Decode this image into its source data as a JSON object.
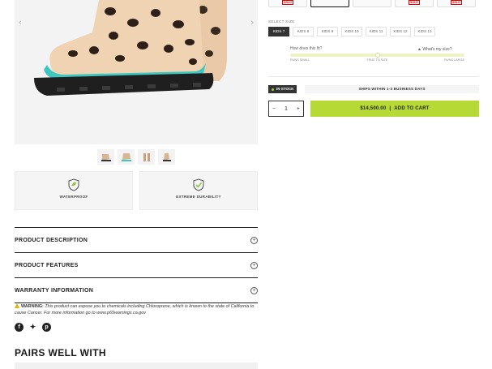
{
  "gallery": {
    "prev": "‹",
    "next": "›"
  },
  "features": [
    {
      "label": "Waterproof",
      "icon": "leaf-shield-icon"
    },
    {
      "label": "Extreme Durability",
      "icon": "check-shield-icon"
    }
  ],
  "accordion": [
    {
      "label": "PRODUCT DESCRIPTION"
    },
    {
      "label": "PRODUCT FEATURES"
    },
    {
      "label": "WARRANTY INFORMATION"
    }
  ],
  "warning": {
    "lead": "WARNING:",
    "text": "This product can expose you to chemicals including Chloroprene, which is known to the state of California to cause Cancer. For more information go to www.p65warnings.ca.gov"
  },
  "social": [
    "facebook-icon",
    "twitter-icon",
    "pinterest-icon"
  ],
  "pairs_title": "PAIRS WELL WITH",
  "sizes": {
    "label": "SELECT SIZE",
    "options": [
      "KIDS 7",
      "KIDS 8",
      "KIDS 9",
      "KIDS 10",
      "KIDS 11",
      "KIDS 12",
      "KIDS 13"
    ],
    "selected": "KIDS 7"
  },
  "fit": {
    "question": "How does this fit?",
    "link": "What's my size?",
    "scale": [
      "RUNS SMALL",
      "TRUE TO SIZE",
      "RUNS LARGE"
    ],
    "value": 0.5
  },
  "stock": {
    "badge": "IN STOCK",
    "shipping": "SHIPS WITHIN 1-3 BUSINESS DAYS"
  },
  "purchase": {
    "quantity": "1",
    "minus": "−",
    "plus": "+",
    "price": "$14,500.00",
    "cta": "ADD TO CART"
  },
  "swatches": {
    "sold_out": "SOLD"
  },
  "colors": {
    "accent": "#b7d935",
    "dark": "#333333",
    "teal": "#3ec6c0"
  }
}
